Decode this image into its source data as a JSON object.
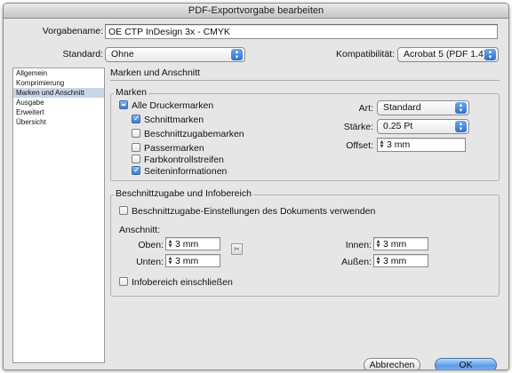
{
  "window": {
    "title": "PDF-Exportvorgabe bearbeiten"
  },
  "preset": {
    "label": "Vorgabename:",
    "value": "OE CTP InDesign 3x - CMYK"
  },
  "standard": {
    "label": "Standard:",
    "value": "Ohne"
  },
  "compat": {
    "label": "Kompatibilität:",
    "value": "Acrobat 5 (PDF 1.4)"
  },
  "sidebar": {
    "items": [
      {
        "label": "Allgemein",
        "selected": false
      },
      {
        "label": "Komprimierung",
        "selected": false
      },
      {
        "label": "Marken und Anschnitt",
        "selected": true
      },
      {
        "label": "Ausgabe",
        "selected": false
      },
      {
        "label": "Erweitert",
        "selected": false
      },
      {
        "label": "Übersicht",
        "selected": false
      }
    ]
  },
  "section": {
    "title": "Marken und Anschnitt"
  },
  "marks": {
    "title": "Marken",
    "all": {
      "label": "Alle Druckermarken",
      "state": "mixed"
    },
    "items": [
      {
        "label": "Schnittmarken",
        "checked": true
      },
      {
        "label": "Beschnittzugabemarken",
        "checked": false
      },
      {
        "label": "Passermarken",
        "checked": false
      },
      {
        "label": "Farbkontrollstreifen",
        "checked": false
      },
      {
        "label": "Seiteninformationen",
        "checked": true
      }
    ],
    "art": {
      "label": "Art:",
      "value": "Standard"
    },
    "staerke": {
      "label": "Stärke:",
      "value": "0.25 Pt"
    },
    "offset": {
      "label": "Offset:",
      "value": "3 mm"
    }
  },
  "bleed": {
    "title": "Beschnittzugabe und Infobereich",
    "use_doc": {
      "label": "Beschnittzugabe-Einstellungen des Dokuments verwenden",
      "checked": false
    },
    "anschnitt_label": "Anschnitt:",
    "oben": {
      "label": "Oben:",
      "value": "3 mm"
    },
    "unten": {
      "label": "Unten:",
      "value": "3 mm"
    },
    "innen": {
      "label": "Innen:",
      "value": "3 mm"
    },
    "aussen": {
      "label": "Außen:",
      "value": "3 mm"
    },
    "slug": {
      "label": "Infobereich einschließen",
      "checked": false
    }
  },
  "buttons": {
    "cancel": "Abbrechen",
    "ok": "OK"
  }
}
